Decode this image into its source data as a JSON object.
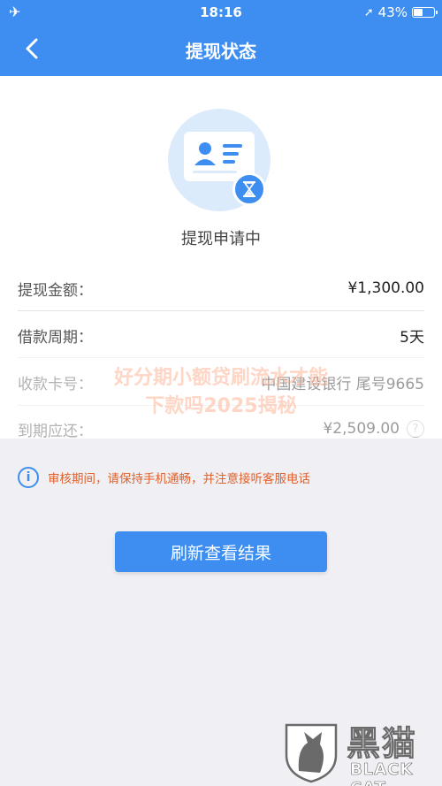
{
  "status_bar": {
    "time": "18:16",
    "battery": "43%",
    "battery_level": 0.43
  },
  "header": {
    "title": "提现状态"
  },
  "status": {
    "label": "提现申请中"
  },
  "details": [
    {
      "label": "提现金额：",
      "value": "¥1,300.00"
    },
    {
      "label": "借款周期：",
      "value": "5天"
    },
    {
      "label": "收款卡号：",
      "value": "中国建设银行 尾号9665"
    },
    {
      "label": "到期应还：",
      "value": "¥2,509.00",
      "help": "?"
    }
  ],
  "notice": {
    "icon_text": "i",
    "text": "审核期间，请保持手机通畅，并注意接听客服电话"
  },
  "actions": {
    "refresh_label": "刷新查看结果"
  },
  "watermark": {
    "line1": "好分期小额贷刷流水才能",
    "line2": "下款吗2025揭秘"
  },
  "logo": {
    "cn": "黑猫",
    "en": "BLACK CAT"
  },
  "colors": {
    "primary": "#3d8ef0",
    "warning": "#e0622c",
    "background": "#efeff4"
  }
}
